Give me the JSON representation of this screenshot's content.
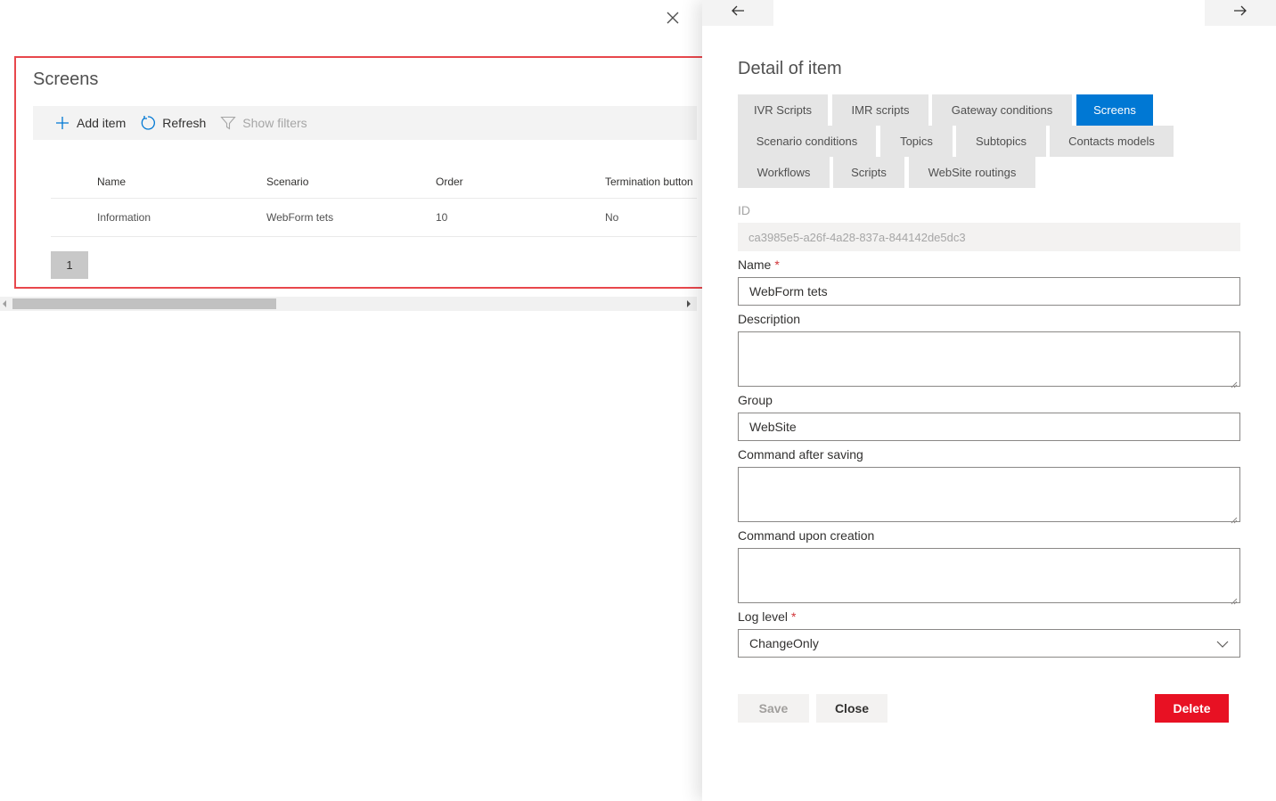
{
  "list_panel": {
    "title": "Screens",
    "commands": {
      "add_item": "Add item",
      "refresh": "Refresh",
      "show_filters": "Show filters"
    },
    "columns": [
      "Name",
      "Scenario",
      "Order",
      "Termination button"
    ],
    "rows": [
      {
        "name": "Information",
        "scenario": "WebForm tets",
        "order": "10",
        "termination_button": "No"
      }
    ],
    "pager": {
      "current_page": "1"
    },
    "icons": {
      "close": "close-icon",
      "add": "plus-icon",
      "refresh": "refresh-icon",
      "filter": "filter-icon"
    }
  },
  "detail_panel": {
    "title": "Detail of item",
    "nav": {
      "prev": "arrow-left-icon",
      "next": "arrow-right-icon"
    },
    "tabs": [
      {
        "label": "IVR Scripts",
        "active": false
      },
      {
        "label": "IMR scripts",
        "active": false
      },
      {
        "label": "Gateway conditions",
        "active": false
      },
      {
        "label": "Screens",
        "active": true
      },
      {
        "label": "Scenario conditions",
        "active": false
      },
      {
        "label": "Topics",
        "active": false
      },
      {
        "label": "Subtopics",
        "active": false
      },
      {
        "label": "Contacts models",
        "active": false
      },
      {
        "label": "Workflows",
        "active": false
      },
      {
        "label": "Scripts",
        "active": false
      },
      {
        "label": "WebSite routings",
        "active": false
      }
    ],
    "form": {
      "id_label": "ID",
      "id_value": "ca3985e5-a26f-4a28-837a-844142de5dc3",
      "name_label": "Name",
      "name_value": "WebForm tets",
      "description_label": "Description",
      "description_value": "",
      "group_label": "Group",
      "group_value": "WebSite",
      "command_after_saving_label": "Command after saving",
      "command_after_saving_value": "",
      "command_upon_creation_label": "Command upon creation",
      "command_upon_creation_value": "",
      "log_level_label": "Log level",
      "log_level_value": "ChangeOnly",
      "required_mark": "*"
    },
    "buttons": {
      "save": "Save",
      "close": "Close",
      "delete": "Delete"
    }
  },
  "colors": {
    "accent": "#0078d4",
    "danger": "#e81123",
    "highlight_border": "#e8474c",
    "required": "#d13438"
  }
}
